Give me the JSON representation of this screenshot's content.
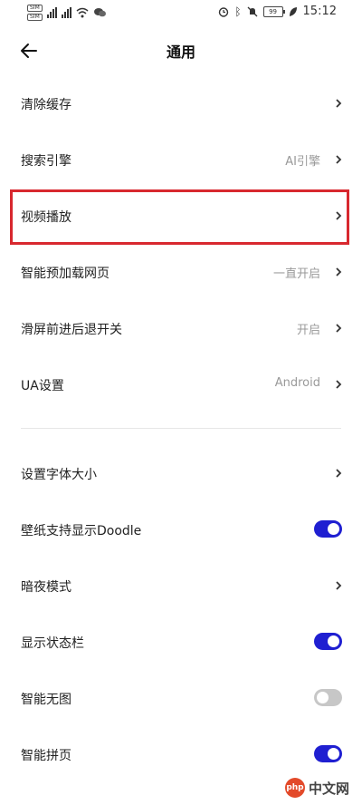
{
  "status_bar": {
    "sim1": "SIM",
    "sim2": "SIM",
    "time": "15:12",
    "battery": "99"
  },
  "header": {
    "title": "通用",
    "back_icon": "arrow-left-icon"
  },
  "rows": [
    {
      "label": "清除缓存",
      "value": "",
      "control": "chevron"
    },
    {
      "label": "搜索引擎",
      "value": "AI引擎",
      "control": "chevron"
    },
    {
      "label": "视频播放",
      "value": "",
      "control": "chevron",
      "highlighted": true
    },
    {
      "label": "智能预加载网页",
      "value": "一直开启",
      "control": "chevron"
    },
    {
      "label": "滑屏前进后退开关",
      "value": "开启",
      "control": "chevron"
    },
    {
      "label": "UA设置",
      "value": "Android",
      "control": "chevron"
    },
    {
      "label": "设置字体大小",
      "value": "",
      "control": "chevron"
    },
    {
      "label": "壁纸支持显示Doodle",
      "control": "toggle",
      "on": true
    },
    {
      "label": "暗夜模式",
      "value": "",
      "control": "chevron"
    },
    {
      "label": "显示状态栏",
      "control": "toggle",
      "on": true
    },
    {
      "label": "智能无图",
      "control": "toggle",
      "on": false
    },
    {
      "label": "智能拼页",
      "control": "toggle",
      "on": true
    }
  ],
  "colors": {
    "toggle_on": "#1f1fd1",
    "toggle_off": "#c7c7c7",
    "highlight_border": "#d8282f"
  },
  "watermark": {
    "logo_text": "php",
    "site_text": "中文网"
  }
}
